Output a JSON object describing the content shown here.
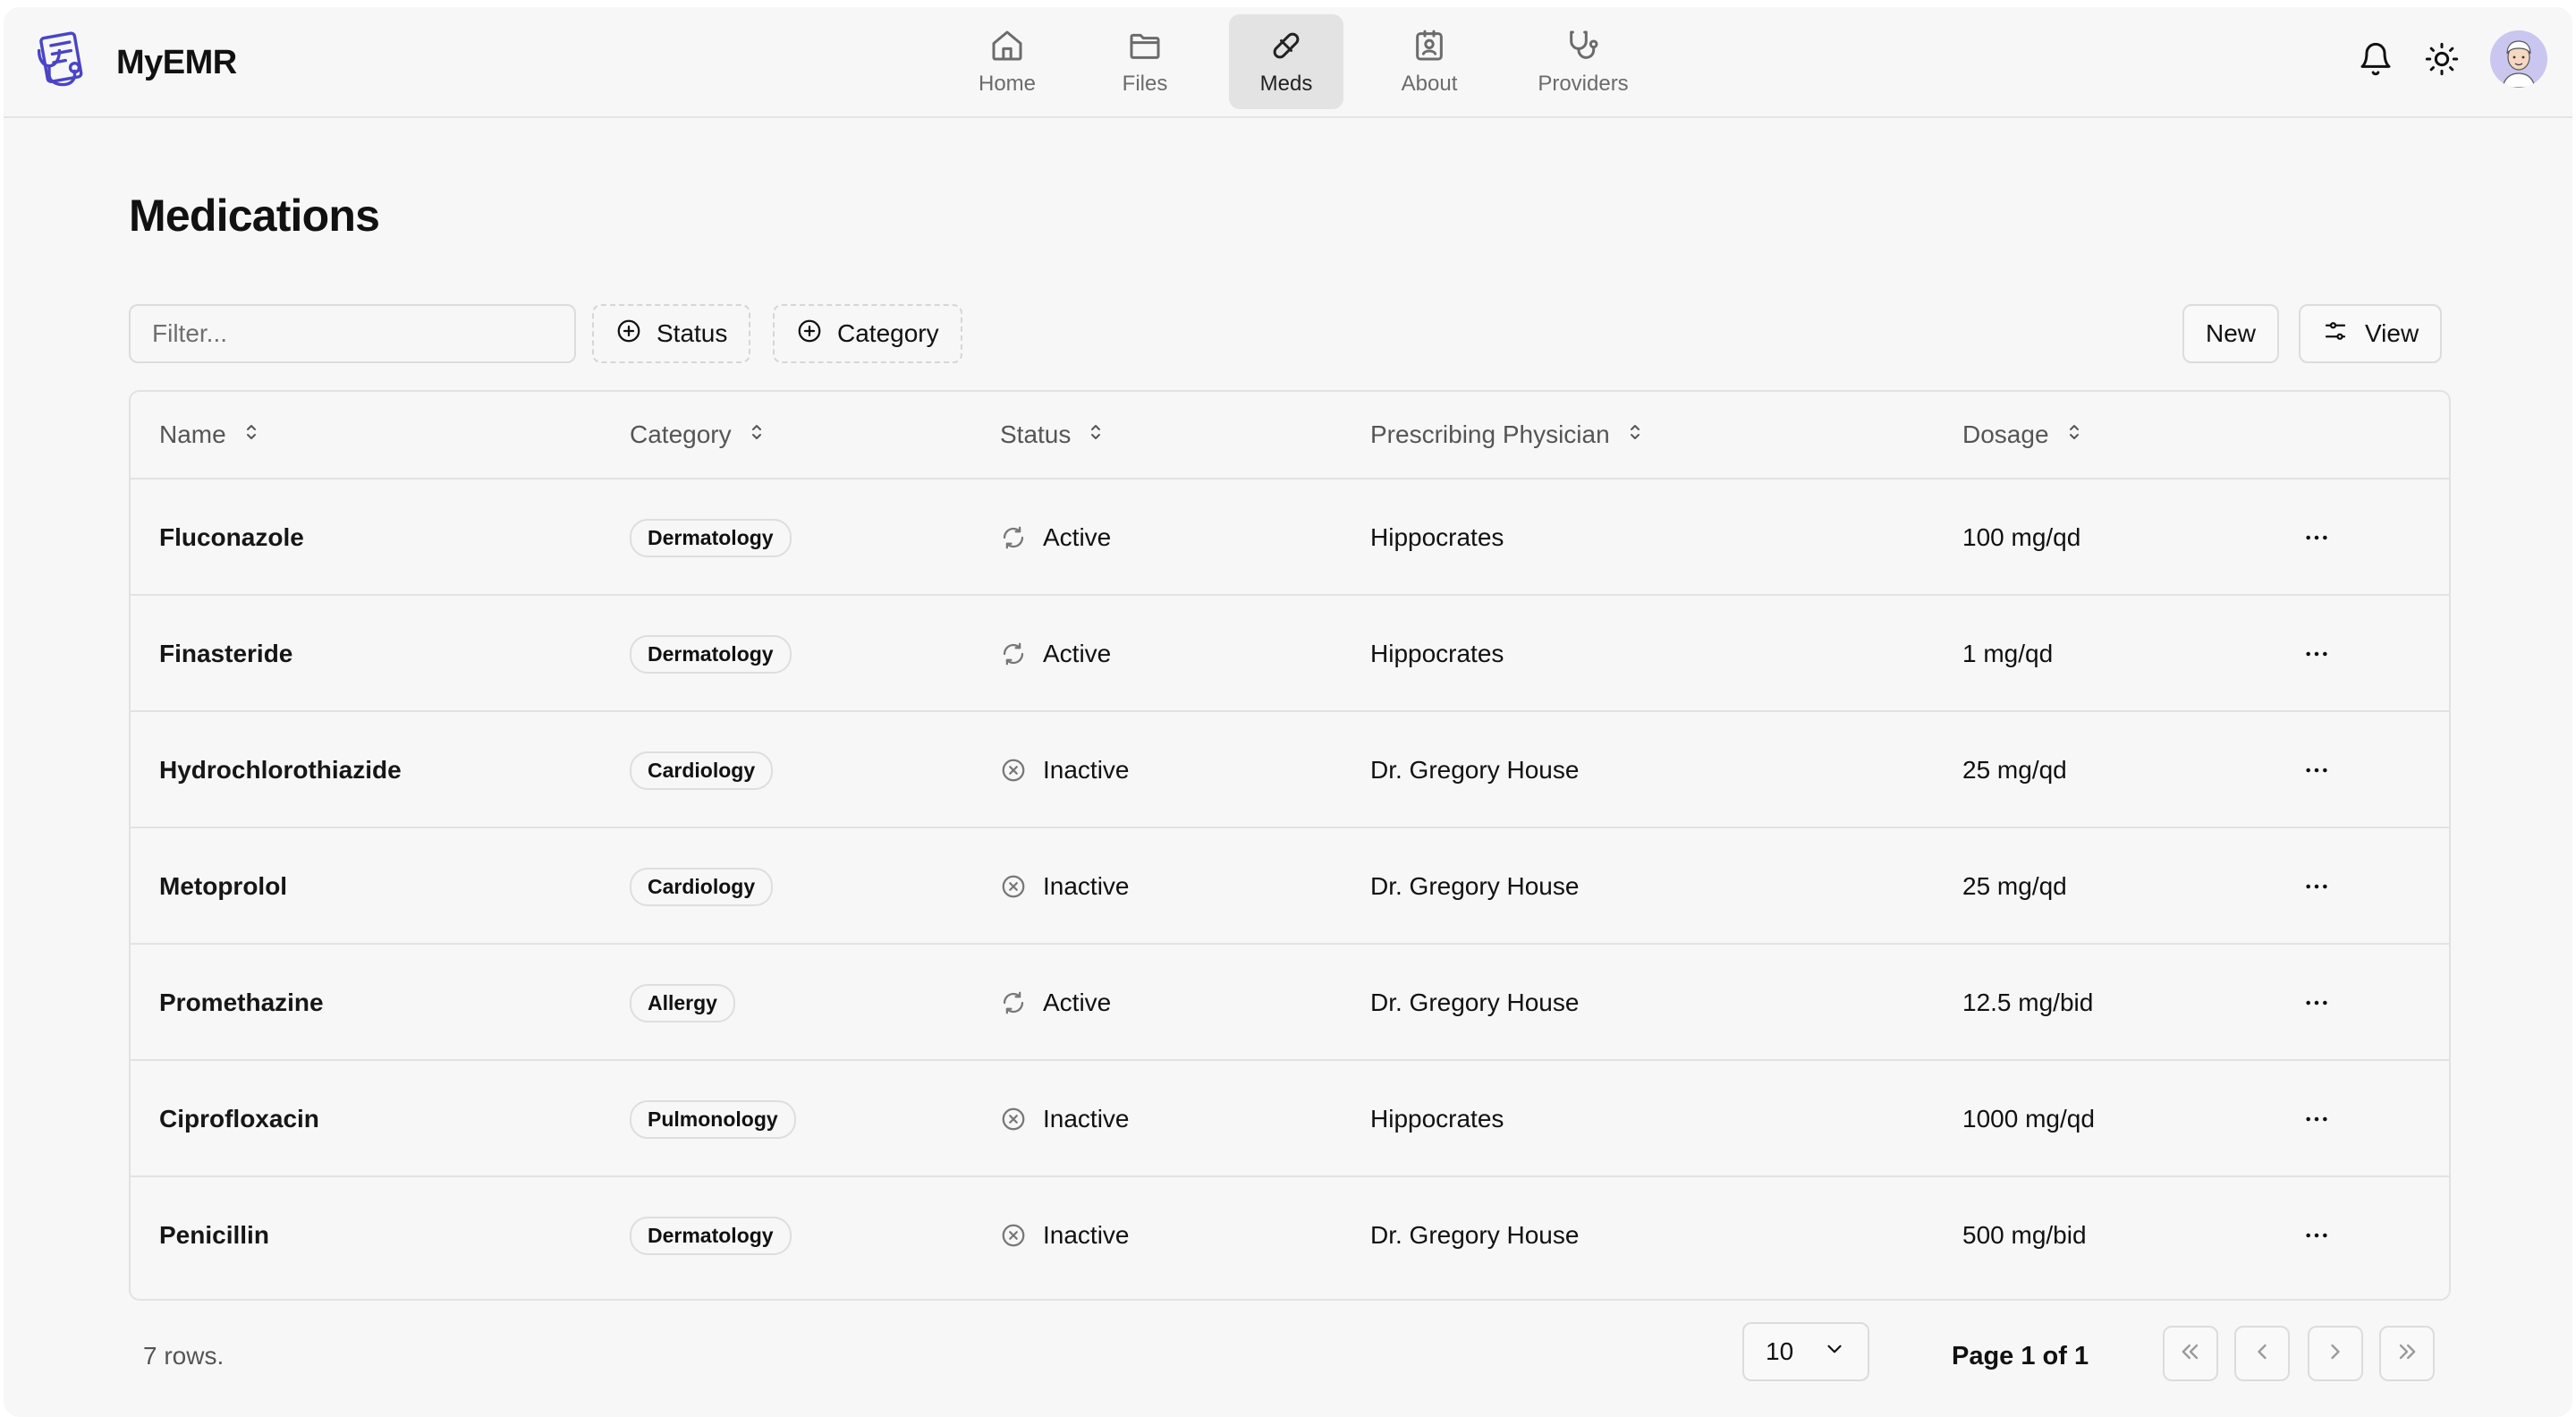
{
  "app": {
    "name": "MyEMR"
  },
  "nav": {
    "items": [
      {
        "label": "Home",
        "icon": "home-icon",
        "active": false
      },
      {
        "label": "Files",
        "icon": "folder-icon",
        "active": false
      },
      {
        "label": "Meds",
        "icon": "pill-icon",
        "active": true
      },
      {
        "label": "About",
        "icon": "contact-card-icon",
        "active": false
      },
      {
        "label": "Providers",
        "icon": "stethoscope-icon",
        "active": false
      }
    ]
  },
  "header": {
    "icons": [
      "bell-icon",
      "sun-icon",
      "avatar"
    ]
  },
  "page": {
    "title": "Medications"
  },
  "toolbar": {
    "filter_placeholder": "Filter...",
    "facets": [
      "Status",
      "Category"
    ],
    "new_label": "New",
    "view_label": "View"
  },
  "table": {
    "columns": [
      "Name",
      "Category",
      "Status",
      "Prescribing Physician",
      "Dosage"
    ],
    "rows": [
      {
        "name": "Fluconazole",
        "category": "Dermatology",
        "status": "Active",
        "physician": "Hippocrates",
        "dosage": "100 mg/qd"
      },
      {
        "name": "Finasteride",
        "category": "Dermatology",
        "status": "Active",
        "physician": "Hippocrates",
        "dosage": "1 mg/qd"
      },
      {
        "name": "Hydrochlorothiazide",
        "category": "Cardiology",
        "status": "Inactive",
        "physician": "Dr. Gregory House",
        "dosage": "25 mg/qd"
      },
      {
        "name": "Metoprolol",
        "category": "Cardiology",
        "status": "Inactive",
        "physician": "Dr. Gregory House",
        "dosage": "25 mg/qd"
      },
      {
        "name": "Promethazine",
        "category": "Allergy",
        "status": "Active",
        "physician": "Dr. Gregory House",
        "dosage": "12.5 mg/bid"
      },
      {
        "name": "Ciprofloxacin",
        "category": "Pulmonology",
        "status": "Inactive",
        "physician": "Hippocrates",
        "dosage": "1000 mg/qd"
      },
      {
        "name": "Penicillin",
        "category": "Dermatology",
        "status": "Inactive",
        "physician": "Dr. Gregory House",
        "dosage": "500 mg/bid"
      }
    ]
  },
  "footer": {
    "rows_text": "7 rows.",
    "page_size": "10",
    "page_text": "Page 1 of 1"
  }
}
